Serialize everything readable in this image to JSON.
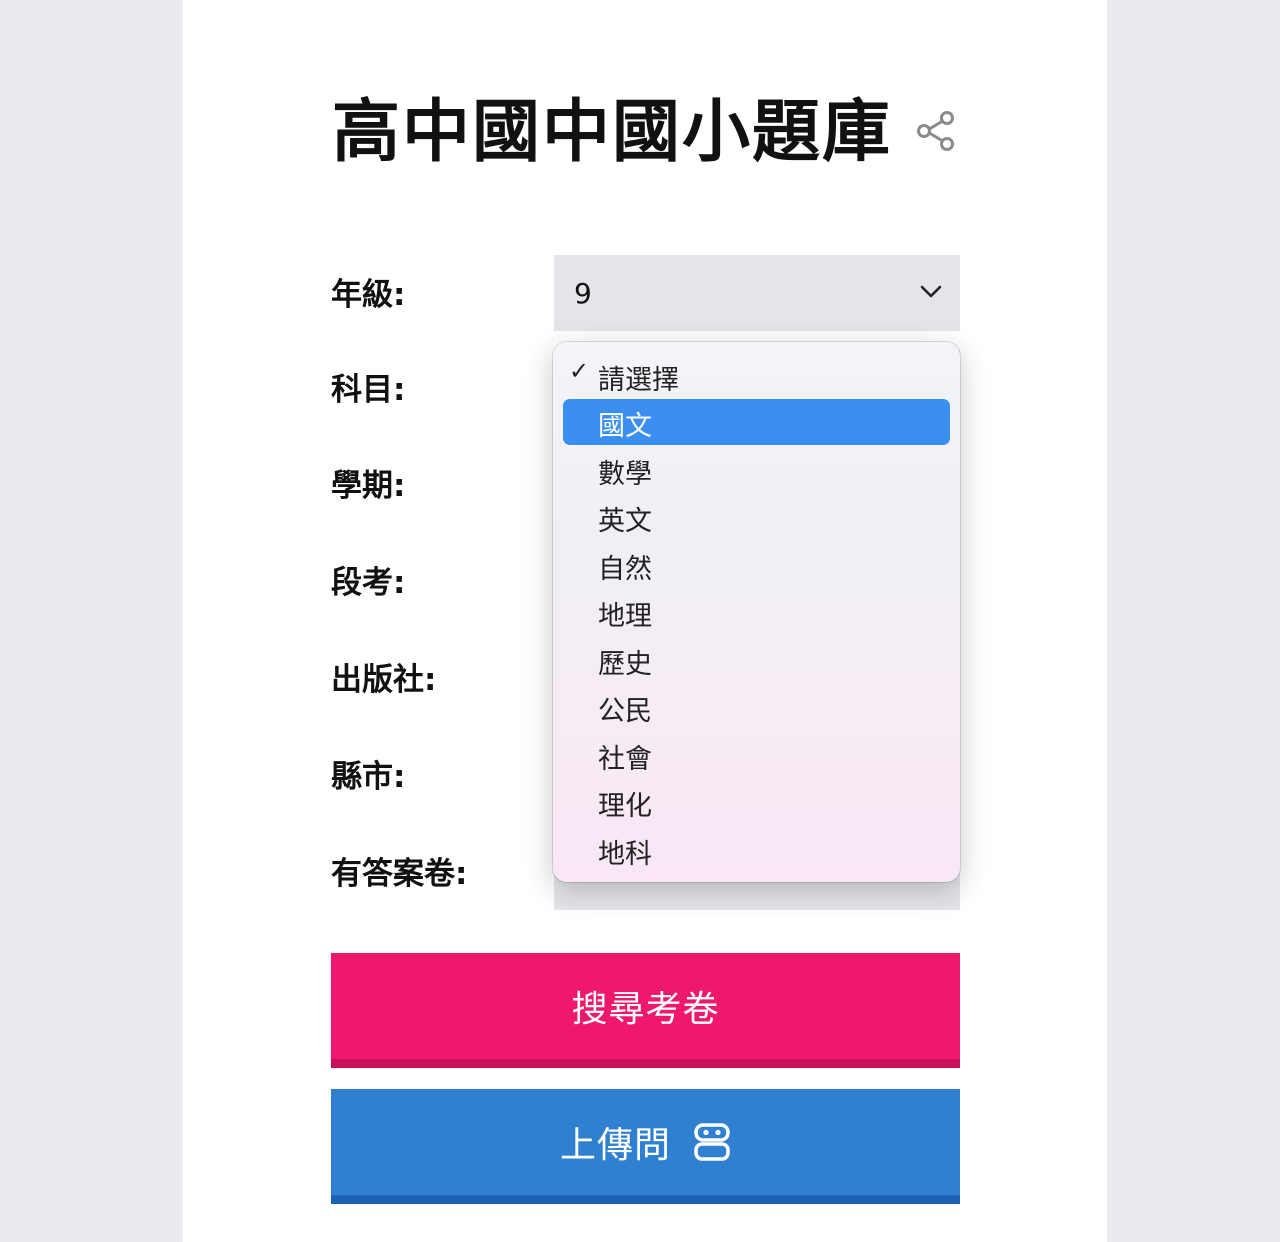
{
  "page": {
    "title": "高中國中國小題庫",
    "share_icon": "share-icon"
  },
  "form": {
    "fields": [
      {
        "label": "年級:",
        "value": "9"
      },
      {
        "label": "科目:",
        "value": ""
      },
      {
        "label": "學期:",
        "value": ""
      },
      {
        "label": "段考:",
        "value": ""
      },
      {
        "label": "出版社:",
        "value": ""
      },
      {
        "label": "縣市:",
        "value": ""
      },
      {
        "label": "有答案卷:",
        "value": ""
      }
    ]
  },
  "dropdown": {
    "checked_index": 0,
    "highlighted_index": 1,
    "options": [
      "請選擇",
      "國文",
      "數學",
      "英文",
      "自然",
      "地理",
      "歷史",
      "公民",
      "社會",
      "理化",
      "地科"
    ]
  },
  "buttons": {
    "search_label": "搜尋考卷",
    "search_color": "#f0186c",
    "upload_label": "上傳問",
    "upload_color": "#2f80d0",
    "upload_icon": "robot-icon"
  }
}
